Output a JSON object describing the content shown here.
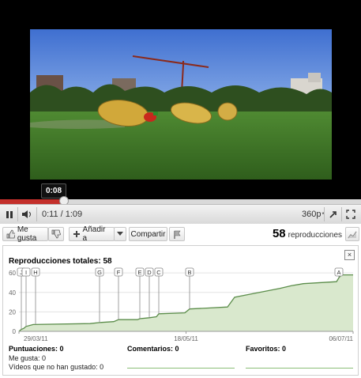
{
  "player": {
    "tooltip_time": "0:08",
    "progress_fraction": 0.175,
    "time_display": "0:11 / 1:09",
    "quality": "360p",
    "quality_superscript": "*"
  },
  "actions": {
    "like_label": "Me gusta",
    "add_label": "Añadir a",
    "share_label": "Compartir",
    "views_count": "58",
    "views_label": "reproducciones"
  },
  "stats": {
    "title": "Reproducciones totales: 58",
    "close_label": "×",
    "ratings_title": "Puntuaciones: 0",
    "likes_text": "Me gusta: 0",
    "dislikes_text": "Vídeos que no han gustado: 0",
    "comments_title": "Comentarios: 0",
    "favorites_title": "Favoritos: 0"
  },
  "chart_data": {
    "type": "area",
    "y_ticks": [
      "0",
      "20",
      "40",
      "60"
    ],
    "ylim": [
      0,
      65
    ],
    "x_tick_labels": [
      "29/03/11",
      "18/05/11",
      "06/07/11"
    ],
    "markers": [
      {
        "label": "J",
        "day": 1
      },
      {
        "label": "I",
        "day": 3
      },
      {
        "label": "H",
        "day": 7
      },
      {
        "label": "G",
        "day": 34
      },
      {
        "label": "F",
        "day": 42
      },
      {
        "label": "E",
        "day": 51
      },
      {
        "label": "D",
        "day": 55
      },
      {
        "label": "C",
        "day": 59
      },
      {
        "label": "B",
        "day": 72
      },
      {
        "label": "A",
        "day": 135
      }
    ],
    "series_points": [
      [
        0,
        0
      ],
      [
        1,
        2
      ],
      [
        2,
        3
      ],
      [
        3,
        5
      ],
      [
        6,
        7
      ],
      [
        30,
        8
      ],
      [
        34,
        9
      ],
      [
        40,
        10
      ],
      [
        42,
        12
      ],
      [
        50,
        12
      ],
      [
        51,
        13
      ],
      [
        55,
        14
      ],
      [
        58,
        15
      ],
      [
        59,
        18
      ],
      [
        70,
        19
      ],
      [
        72,
        23
      ],
      [
        80,
        24
      ],
      [
        88,
        25
      ],
      [
        91,
        35
      ],
      [
        95,
        37
      ],
      [
        110,
        44
      ],
      [
        115,
        47
      ],
      [
        120,
        49
      ],
      [
        134,
        51
      ],
      [
        135,
        55
      ],
      [
        136,
        58
      ],
      [
        141,
        58
      ]
    ],
    "x_max_day": 141,
    "colors": {
      "line": "#5b8d4a",
      "fill": "#d9e8cd",
      "grid": "#e3e3e3"
    }
  }
}
